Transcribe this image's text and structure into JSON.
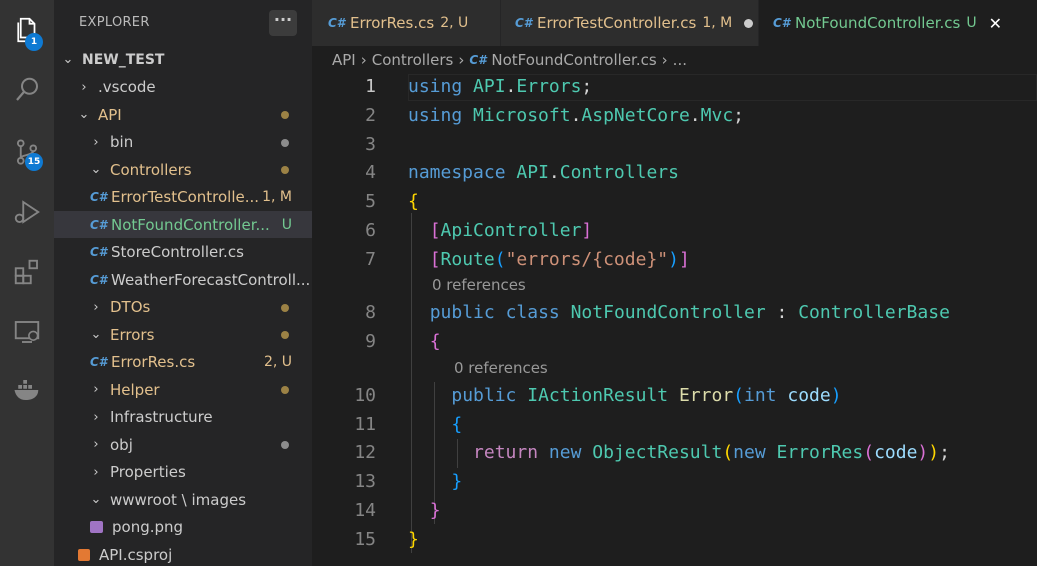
{
  "activity_bar": {
    "explorer_badge": "1",
    "source_control_badge": "15"
  },
  "explorer": {
    "title": "EXPLORER",
    "more_label": "···",
    "items": [
      {
        "label": "NEW_TEST",
        "chevron": "⌄",
        "color": "#cccccc",
        "status": "",
        "dot": ""
      },
      {
        "label": ".vscode",
        "chevron": "›",
        "color": "#cccccc",
        "status": "",
        "dot": ""
      },
      {
        "label": "API",
        "chevron": "⌄",
        "color": "#e2c08d",
        "status": "",
        "dot": "modified"
      },
      {
        "label": "bin",
        "chevron": "›",
        "color": "#cccccc",
        "status": "",
        "dot": "ignored"
      },
      {
        "label": "Controllers",
        "chevron": "⌄",
        "color": "#e2c08d",
        "status": "",
        "dot": "modified"
      },
      {
        "label": "ErrorTestControlle...",
        "chevron": "",
        "color": "#e2c08d",
        "status": "1, M",
        "dot": ""
      },
      {
        "label": "NotFoundController...",
        "chevron": "",
        "color": "#73c991",
        "status": "U",
        "dot": ""
      },
      {
        "label": "StoreController.cs",
        "chevron": "",
        "color": "#cccccc",
        "status": "",
        "dot": ""
      },
      {
        "label": "WeatherForecastControll...",
        "chevron": "",
        "color": "#cccccc",
        "status": "",
        "dot": ""
      },
      {
        "label": "DTOs",
        "chevron": "›",
        "color": "#e2c08d",
        "status": "",
        "dot": "modified"
      },
      {
        "label": "Errors",
        "chevron": "⌄",
        "color": "#e2c08d",
        "status": "",
        "dot": "modified"
      },
      {
        "label": "ErrorRes.cs",
        "chevron": "",
        "color": "#e2c08d",
        "status": "2, U",
        "dot": ""
      },
      {
        "label": "Helper",
        "chevron": "›",
        "color": "#e2c08d",
        "status": "",
        "dot": "modified"
      },
      {
        "label": "Infrastructure",
        "chevron": "›",
        "color": "#cccccc",
        "status": "",
        "dot": ""
      },
      {
        "label": "obj",
        "chevron": "›",
        "color": "#cccccc",
        "status": "",
        "dot": "ignored"
      },
      {
        "label": "Properties",
        "chevron": "›",
        "color": "#cccccc",
        "status": "",
        "dot": ""
      },
      {
        "label": "wwwroot \\ images",
        "chevron": "⌄",
        "color": "#cccccc",
        "status": "",
        "dot": ""
      },
      {
        "label": "pong.png",
        "chevron": "",
        "color": "#cccccc",
        "status": "",
        "dot": ""
      },
      {
        "label": "API.csproj",
        "chevron": "",
        "color": "#cccccc",
        "status": "",
        "dot": ""
      }
    ]
  },
  "tabs": [
    {
      "label": "ErrorRes.cs",
      "status": "2, U",
      "icon": "C#"
    },
    {
      "label": "ErrorTestController.cs",
      "status": "1, M",
      "icon": "C#"
    },
    {
      "label": "NotFoundController.cs",
      "status": "U",
      "icon": "C#",
      "close": "✕"
    }
  ],
  "breadcrumb": {
    "items": [
      "API",
      "Controllers",
      "NotFoundController.cs",
      "..."
    ]
  },
  "editor": {
    "code_lens": "0 references",
    "line_numbers": [
      "1",
      "2",
      "3",
      "4",
      "5",
      "6",
      "7",
      "8",
      "9",
      "10",
      "11",
      "12",
      "13",
      "14",
      "15"
    ],
    "colors": {
      "keyword": "#569cd6",
      "control": "#c586c0",
      "type": "#4ec9b0",
      "string": "#ce9178",
      "param": "#9cdcfe",
      "method": "#dcdcaa",
      "brace1": "#ffd700",
      "brace2": "#da70d6",
      "brace3": "#179fff"
    }
  }
}
